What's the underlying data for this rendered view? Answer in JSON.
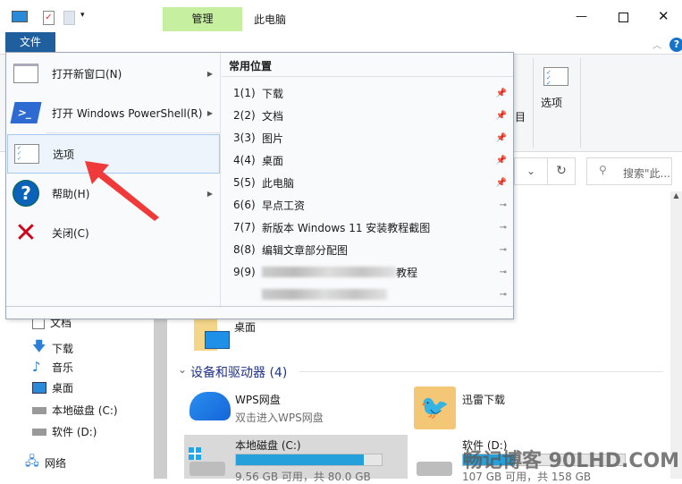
{
  "titlebar": {
    "tab_manage": "管理",
    "title": "此电脑",
    "minimize": "—",
    "maximize": "☐",
    "close": "✕",
    "manage_color": "#c6efa0"
  },
  "ribbon": {
    "file_tab": "文件",
    "options_label": "选项",
    "partial_label": "目",
    "file_tab_color": "#1f5f9e"
  },
  "address": {
    "search_placeholder": "搜索\"此..."
  },
  "file_menu": {
    "left_items": [
      {
        "label": "打开新窗口(N)",
        "icon": "window-icon",
        "submenu": true
      },
      {
        "label": "打开 Windows PowerShell(R)",
        "icon": "powershell-icon",
        "submenu": true
      },
      {
        "label": "选项",
        "icon": "options-icon",
        "submenu": false,
        "selected": true
      },
      {
        "label": "帮助(H)",
        "icon": "help-icon",
        "submenu": true
      },
      {
        "label": "关闭(C)",
        "icon": "close-x-icon",
        "submenu": false
      }
    ],
    "frequent_header": "常用位置",
    "frequent": [
      {
        "num": "1(1)",
        "label": "下载",
        "pinned": true
      },
      {
        "num": "2(2)",
        "label": "文档",
        "pinned": true
      },
      {
        "num": "3(3)",
        "label": "图片",
        "pinned": true
      },
      {
        "num": "4(4)",
        "label": "桌面",
        "pinned": true
      },
      {
        "num": "5(5)",
        "label": "此电脑",
        "pinned": true
      },
      {
        "num": "6(6)",
        "label": "早点工资",
        "pinned": false
      },
      {
        "num": "7(7)",
        "label": "新版本 Windows 11 安装教程截图",
        "pinned": false
      },
      {
        "num": "8(8)",
        "label": "编辑文章部分配图",
        "pinned": false
      },
      {
        "num": "9(9)",
        "label": "教程",
        "pinned": false,
        "blurred": true
      },
      {
        "num": "",
        "label": "",
        "pinned": false,
        "blurred": true
      }
    ]
  },
  "nav": {
    "items": [
      "文档",
      "下载",
      "音乐",
      "桌面",
      "本地磁盘 (C:)",
      "软件 (D:)",
      "网络"
    ]
  },
  "content": {
    "desktop_label": "桌面",
    "section": "设备和驱动器 (4)",
    "wps": {
      "name": "WPS网盘",
      "sub": "双击进入WPS网盘"
    },
    "xunlei": {
      "name": "迅雷下载"
    },
    "drive_c": {
      "name": "本地磁盘 (C:)",
      "info": "9.56 GB 可用，共 80.0 GB",
      "used_fraction": 0.88
    },
    "drive_d": {
      "name": "软件 (D:)",
      "info": "107 GB 可用，共 158 GB",
      "used_fraction": 0.32
    }
  },
  "watermark": "畅记博客 90LHD.COM"
}
